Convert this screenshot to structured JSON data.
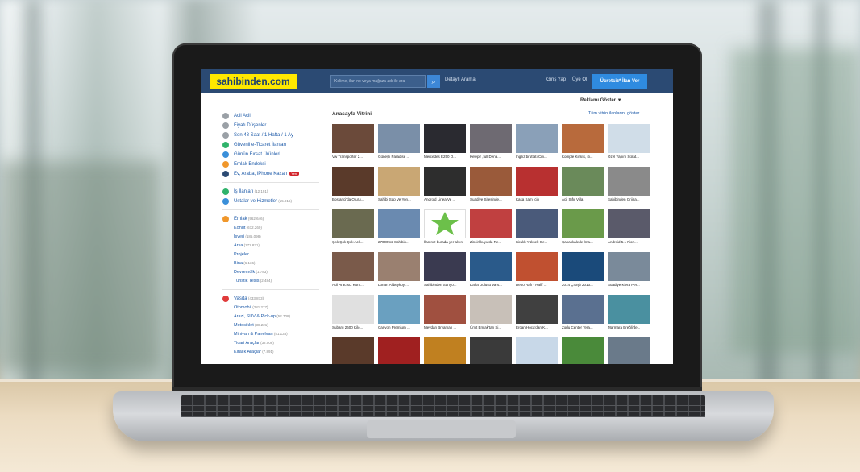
{
  "header": {
    "logo": "sahibinden.com",
    "search_placeholder": "Kelime, ilan no veya mağaza adı ile ara",
    "advanced_search": "Detaylı Arama",
    "login": "Giriş Yap",
    "register": "Üye Ol",
    "post_ad": "Ücretsiz* İlan Ver"
  },
  "ad_toggle": "Reklamı Göster ▼",
  "sidebar": {
    "items": [
      {
        "label": "Acil Acil",
        "count": "",
        "color": "#9aa0a6"
      },
      {
        "label": "Fiyatı Düşenler",
        "count": "",
        "color": "#9aa0a6"
      },
      {
        "label": "Son 48 Saat / 1 Hafta / 1 Ay",
        "count": "",
        "color": "#9aa0a6"
      },
      {
        "label": "Güvenli e-Ticaret İlanları",
        "count": "",
        "color": "#2fb36b"
      },
      {
        "label": "Günün Fırsat Ürünleri",
        "count": "",
        "color": "#3a8fd9"
      },
      {
        "label": "Emlak Endeksi",
        "count": "",
        "color": "#f0972b"
      },
      {
        "label": "Ev, Araba, iPhone Kazan",
        "count": "",
        "color": "#2b4a73",
        "badge": "Yeni"
      }
    ],
    "group2": [
      {
        "label": "İş İlanları",
        "count": "(12.191)",
        "color": "#2fb36b"
      },
      {
        "label": "Ustalar ve Hizmetler",
        "count": "(15.916)",
        "color": "#3a8fd9"
      }
    ],
    "emlak": {
      "label": "Emlak",
      "count": "(962.646)",
      "color": "#f0972b",
      "subs": [
        {
          "label": "Konut",
          "count": "(672.260)"
        },
        {
          "label": "İşyeri",
          "count": "(185.098)"
        },
        {
          "label": "Arsa",
          "count": "(172.831)"
        },
        {
          "label": "Projeler",
          "count": ""
        },
        {
          "label": "Bina",
          "count": "(6.136)"
        },
        {
          "label": "Devremülk",
          "count": "(1.783)"
        },
        {
          "label": "Turistik Tesis",
          "count": "(2.484)"
        }
      ]
    },
    "vasita": {
      "label": "Vasıta",
      "count": "(433.873)",
      "color": "#e03b3b",
      "subs": [
        {
          "label": "Otomobil",
          "count": "(281.277)"
        },
        {
          "label": "Arazi, SUV & Pick-up",
          "count": "(52.708)"
        },
        {
          "label": "Motosiklet",
          "count": "(38.221)"
        },
        {
          "label": "Minivan & Panelvan",
          "count": "(51.133)"
        },
        {
          "label": "Ticari Araçlar",
          "count": "(32.508)"
        },
        {
          "label": "Kiralık Araçlar",
          "count": "(7.891)"
        }
      ]
    }
  },
  "showcase": {
    "title": "Anasayfa Vitrini",
    "show_all": "Tüm vitrin ilanlarını göster",
    "items": [
      {
        "caption": "Vw Transporter 2...",
        "color": "#6b4a3a"
      },
      {
        "caption": "Güneşli Paradise ...",
        "color": "#7a8fa8"
      },
      {
        "caption": "Mercedes E250 O...",
        "color": "#2a2a30"
      },
      {
        "caption": "Kelepir ,full Dena...",
        "color": "#6e6a72"
      },
      {
        "caption": "İngiliz bruttatı Cm...",
        "color": "#8aa0b8"
      },
      {
        "caption": "Komple Kiralık, iti...",
        "color": "#b86a3c"
      },
      {
        "caption": "Özel Yapım Sürat...",
        "color": "#d0dde8"
      },
      {
        "caption": "Bostanci'da Oturu...",
        "color": "#5a3a2a"
      },
      {
        "caption": "Sahibi Sap Ve Yon...",
        "color": "#c9a774"
      },
      {
        "caption": "Android Linea Ve ...",
        "color": "#2d2d2d"
      },
      {
        "caption": "Suadiye Sitesinde...",
        "color": "#9a5a3a"
      },
      {
        "caption": "Kasa Sam İçin",
        "color": "#b83030"
      },
      {
        "caption": "Acil Sıfır Villa",
        "color": "#6a8a5a"
      },
      {
        "caption": "Sahibinden Orjina...",
        "color": "#8a8a8a"
      },
      {
        "caption": "Çok Çok Çok Acil...",
        "color": "#6a6a50"
      },
      {
        "caption": "27000m2 Sahibin...",
        "color": "#6a8ab0"
      },
      {
        "caption": "İlanınız burada yer alsın",
        "color": "#ffffff"
      },
      {
        "caption": "Zincirlikuyu'da Re...",
        "color": "#c04040"
      },
      {
        "caption": "Kiralık Yüksek Ge...",
        "color": "#4a5a7a"
      },
      {
        "caption": "Çanakkalede İma...",
        "color": "#6a9a4a"
      },
      {
        "caption": "Android 5.1 Fiori...",
        "color": "#5a5a6a"
      },
      {
        "caption": "Acil Aracısız Kom...",
        "color": "#7a5a4a"
      },
      {
        "caption": "Lonart Alibeyköy ...",
        "color": "#9a8070"
      },
      {
        "caption": "Sahibinden Sarıyo...",
        "color": "#3a3a50"
      },
      {
        "caption": "Daha Dolusu Vars...",
        "color": "#2a5a8a"
      },
      {
        "caption": "Depo Rafı - Hafif ...",
        "color": "#c05030"
      },
      {
        "caption": "2014 Çıkışlı 2013...",
        "color": "#1a4a7a"
      },
      {
        "caption": "Suadiye Kiera Per...",
        "color": "#7a8a9a"
      },
      {
        "caption": "Subaru 2600 Kilo...",
        "color": "#e0e0e0"
      },
      {
        "caption": "Canyon Premium ...",
        "color": "#6aa0c0"
      },
      {
        "caption": "Meydan Bryaman ...",
        "color": "#a05040"
      },
      {
        "caption": "Ümit Emlak'tan Si...",
        "color": "#c8c0b8"
      },
      {
        "caption": "Ercan Hoca'dan K...",
        "color": "#404040"
      },
      {
        "caption": "Zorlu Center Tera...",
        "color": "#5a7090"
      },
      {
        "caption": "Marmara Ereğli'de...",
        "color": "#4a90a0"
      },
      {
        "caption": "",
        "color": "#5a3a2a"
      },
      {
        "caption": "",
        "color": "#a02020"
      },
      {
        "caption": "",
        "color": "#c08020"
      },
      {
        "caption": "",
        "color": "#3a3a3a"
      },
      {
        "caption": "",
        "color": "#c8d8e8"
      },
      {
        "caption": "",
        "color": "#4a8a3a"
      },
      {
        "caption": "",
        "color": "#6a7a8a"
      }
    ]
  }
}
